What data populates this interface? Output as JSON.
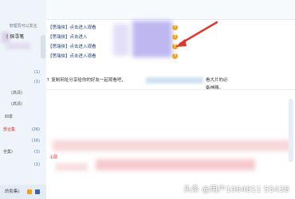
{
  "sidebar": {
    "header": "管理员可以发言",
    "first_name": "( 探寻笔",
    "rows": [
      {
        "name": "",
        "count": "(1)"
      },
      {
        "name": "",
        "count": "(1)"
      },
      {
        "name": "(高清)",
        "count": ""
      },
      {
        "name": "(高清)",
        "count": ""
      },
      {
        "name": "四季",
        "count": ""
      },
      {
        "name": "部合集",
        "count": "(26)"
      },
      {
        "name": "",
        "count": "(16)"
      },
      {
        "name": "全集)",
        "count": "(1)"
      },
      {
        "name": "",
        "count": "(1)"
      }
    ],
    "bottom_label": "的影集)"
  },
  "notices": [
    {
      "tag": "【思瑞侠】",
      "text": "点击进入观看"
    },
    {
      "tag": "【思瑞侠】",
      "text": "点击进入"
    },
    {
      "tag": "【思瑞侠】",
      "text": "点击进入观看"
    },
    {
      "tag": "【思瑞侠】",
      "text": "点击进入观看"
    }
  ],
  "help_icon_glyph": "?",
  "share_text": "↑ 复制网址分享给你的好友一起观看吧，",
  "share_end": "看大片的必备神器。",
  "red_label": "①部",
  "watermark": "头条 @用户1064811 55438",
  "colors": {
    "accent": "#4a72b8",
    "red": "#d9342c",
    "link": "#1e3f7a",
    "orange": "#f0a21a"
  }
}
